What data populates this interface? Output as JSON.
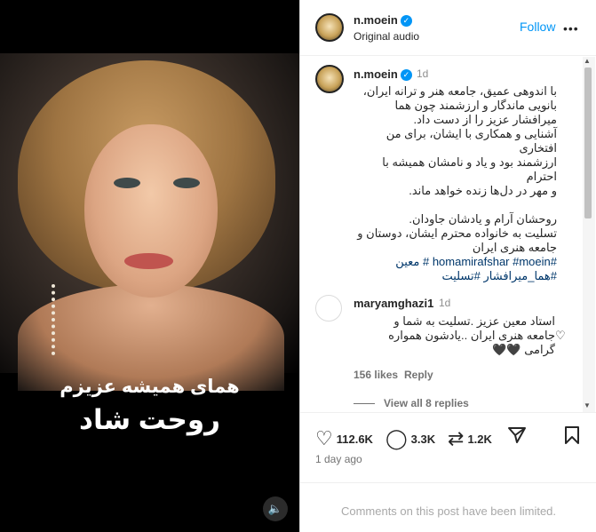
{
  "media": {
    "caption_line1": "همای همیشه عزیزم",
    "caption_line2": "روحت شاد",
    "audio_icon": "speaker-icon"
  },
  "header": {
    "username": "n.moein",
    "subtitle": "Original audio",
    "follow_label": "Follow",
    "more_label": "•••"
  },
  "caption": {
    "username": "n.moein",
    "time": "1d",
    "lines": [
      "با اندوهی عمیق، جامعه هنر و ترانه ایران،",
      "بانویی ماندگار و ارزشمند چون هما",
      "میرافشار عزیز را از دست داد.",
      "آشنایی و همکاری با ایشان، برای من افتخاری",
      "ارزشمند بود و یاد و نامشان همیشه با احترام",
      "و مهر در دل‌ها زنده خواهد ماند."
    ],
    "lines2": [
      "روحشان آرام و یادشان جاودان.",
      "تسلیت به خانواده محترم ایشان، دوستان و",
      "جامعه هنری ایران"
    ],
    "tags_line1": "#homamirafshar #moein # معین",
    "tags_line2": "#هما_میرافشار #تسلیت"
  },
  "comment": {
    "username": "maryamghazi1",
    "time": "1d",
    "lines": [
      "استاد معین عزیز .تسلیت به شما و",
      "جامعه هنری ایران ..یادشون همواره",
      "گرامی 🖤🖤"
    ],
    "likes": "156 likes",
    "reply_label": "Reply",
    "view_replies": "View all 8 replies"
  },
  "actions": {
    "likes_count": "112.6K",
    "comments_count": "3.3K",
    "reposts_count": "1.2K",
    "date": "1 day ago",
    "limited_notice": "Comments on this post have been limited."
  }
}
